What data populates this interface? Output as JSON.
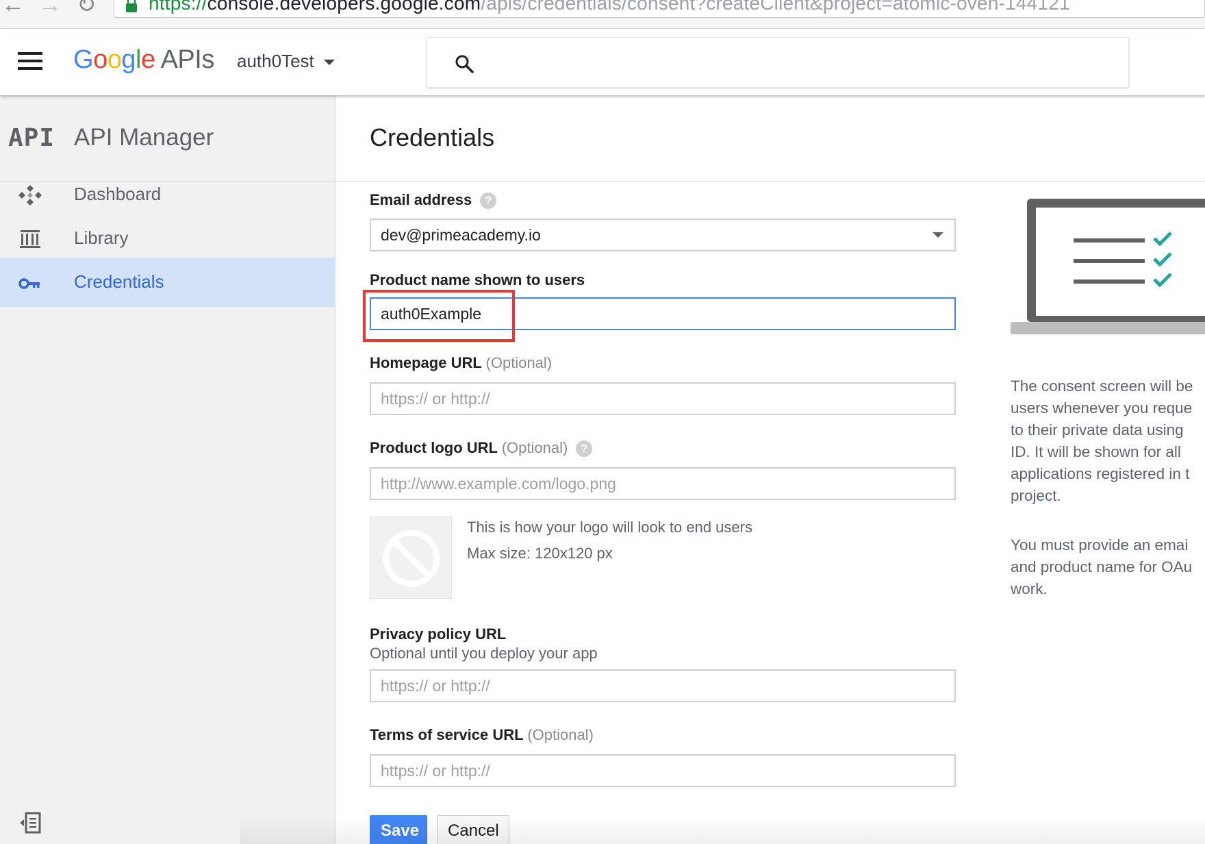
{
  "browser": {
    "url_scheme": "https://",
    "url_host": "console.developers.google.com",
    "url_rest": "/apis/credentials/consent?createClient&project=atomic-oven-144121"
  },
  "header": {
    "logo_letters": [
      "G",
      "o",
      "o",
      "g",
      "l",
      "e"
    ],
    "logo_suffix": "APIs",
    "project_name": "auth0Test",
    "search_placeholder": ""
  },
  "sidebar": {
    "section_glyph": "API",
    "title": "API Manager",
    "items": [
      {
        "label": "Dashboard",
        "icon": "dashboard-icon",
        "active": false
      },
      {
        "label": "Library",
        "icon": "library-icon",
        "active": false
      },
      {
        "label": "Credentials",
        "icon": "key-icon",
        "active": true
      }
    ]
  },
  "main": {
    "title": "Credentials"
  },
  "form": {
    "email": {
      "label": "Email address",
      "value": "dev@primeacademy.io"
    },
    "product_name": {
      "label": "Product name shown to users",
      "value": "auth0Example"
    },
    "homepage": {
      "label": "Homepage URL",
      "optional": "(Optional)",
      "placeholder": "https:// or http://"
    },
    "logo": {
      "label": "Product logo URL",
      "optional": "(Optional)",
      "placeholder": "http://www.example.com/logo.png",
      "preview_caption": "This is how your logo will look to end users",
      "max_size": "Max size: 120x120 px"
    },
    "privacy": {
      "label": "Privacy policy URL",
      "sublabel": "Optional until you deploy your app",
      "placeholder": "https:// or http://"
    },
    "tos": {
      "label": "Terms of service URL",
      "optional": "(Optional)",
      "placeholder": "https:// or http://"
    },
    "save_label": "Save",
    "cancel_label": "Cancel"
  },
  "info": {
    "paragraph1_lines": [
      "The consent screen will be",
      "users whenever you reque",
      "to their private data using",
      "ID. It will be shown for all",
      "applications registered in t",
      "project."
    ],
    "paragraph2_lines": [
      "You must provide an emai",
      "and product name for OAu",
      "work."
    ]
  },
  "colors": {
    "accent": "#4285f4",
    "active_nav_bg": "#d3e2f7",
    "active_nav_text": "#3367d6",
    "highlight": "#e53935",
    "check_teal": "#26a69a"
  }
}
